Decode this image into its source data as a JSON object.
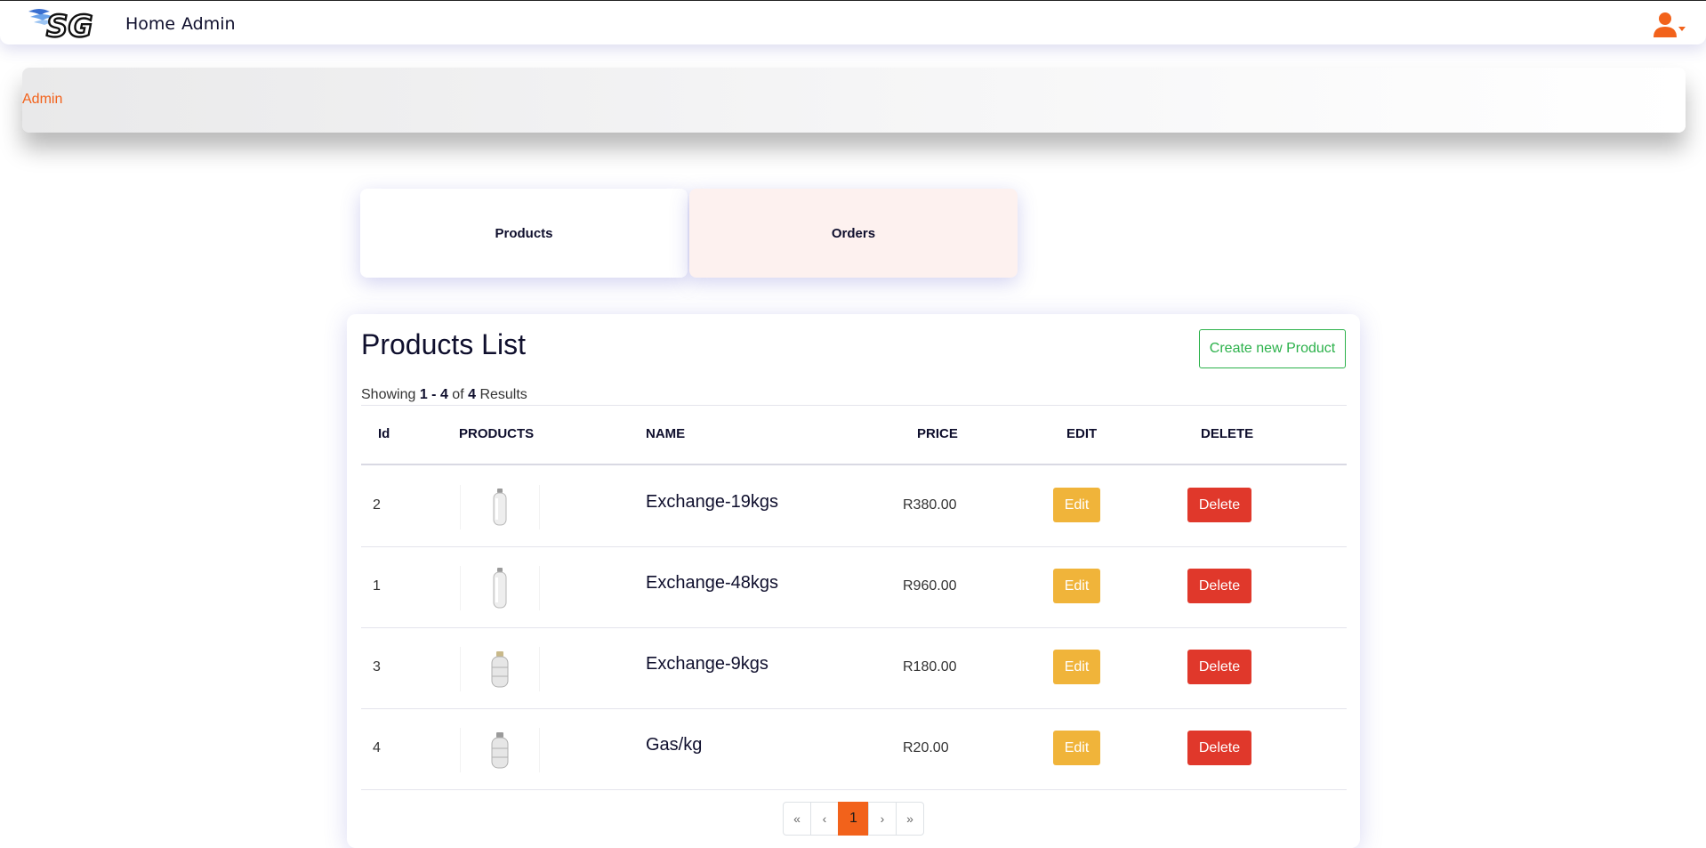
{
  "navbar": {
    "home_label": "Home",
    "admin_label": "Admin",
    "brand_color": "#f2621b"
  },
  "breadcrumb": {
    "items": [
      "Admin"
    ]
  },
  "cards": {
    "products_label": "Products",
    "orders_label": "Orders"
  },
  "products_panel": {
    "title": "Products List",
    "create_button": "Create new Product",
    "showing": {
      "prefix": "Showing",
      "range": "1 - 4",
      "of": "of",
      "total": "4",
      "suffix": "Results"
    },
    "columns": [
      "Id",
      "PRODUCTS",
      "NAME",
      "PRICE",
      "EDIT",
      "DELETE"
    ],
    "rows": [
      {
        "id": "2",
        "image": "gas-cylinder-tall",
        "name": "Exchange-19kgs",
        "price": "R380.00",
        "edit": "Edit",
        "delete": "Delete"
      },
      {
        "id": "1",
        "image": "gas-cylinder-tall",
        "name": "Exchange-48kgs",
        "price": "R960.00",
        "edit": "Edit",
        "delete": "Delete"
      },
      {
        "id": "3",
        "image": "gas-cylinder-short",
        "name": "Exchange-9kgs",
        "price": "R180.00",
        "edit": "Edit",
        "delete": "Delete"
      },
      {
        "id": "4",
        "image": "gas-cylinder-short",
        "name": "Gas/kg",
        "price": "R20.00",
        "edit": "Edit",
        "delete": "Delete"
      }
    ]
  },
  "pagination": {
    "first": "«",
    "prev": "‹",
    "current": "1",
    "next": "›",
    "last": "»"
  }
}
